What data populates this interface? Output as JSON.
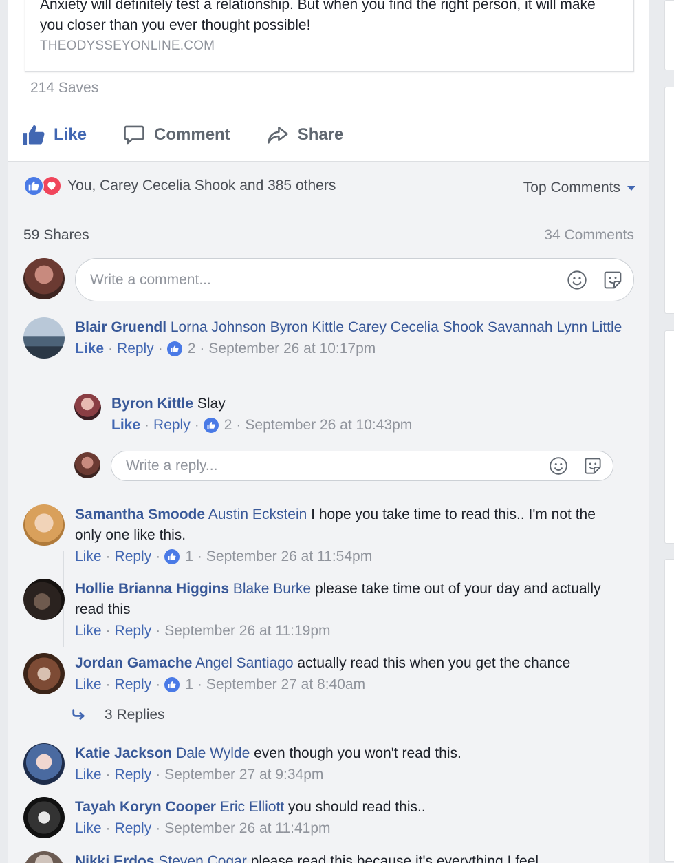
{
  "link_preview": {
    "description": "Anxiety will definitely test a relationship. But when you find the right person, it will make you closer than you ever thought possible!",
    "domain": "THEODYSSEYONLINE.COM"
  },
  "saves": "214 Saves",
  "actions": {
    "like": "Like",
    "comment": "Comment",
    "share": "Share"
  },
  "reactions": {
    "summary": "You, Carey Cecelia Shook and 385 others",
    "sort_label": "Top Comments"
  },
  "shares": "59 Shares",
  "comments_count": "34 Comments",
  "composer": {
    "placeholder": "Write a comment..."
  },
  "reply_composer": {
    "placeholder": "Write a reply..."
  },
  "meta_labels": {
    "like": "Like",
    "reply": "Reply",
    "dot": "·"
  },
  "comments": [
    {
      "author": "Blair Gruendl",
      "mentions": "Lorna Johnson Byron Kittle Carey Cecelia Shook Savannah Lynn Little",
      "text": "",
      "likes": "2",
      "time": "September 26 at 10:17pm",
      "liked": true
    },
    {
      "author": "Byron Kittle",
      "mentions": "",
      "text": "Slay",
      "likes": "2",
      "time": "September 26 at 10:43pm",
      "liked": true
    },
    {
      "author": "Samantha Smoode",
      "mentions": "Austin Eckstein",
      "text": "I hope you take time to read this.. I'm not the only one like this.",
      "likes": "1",
      "time": "September 26 at 11:54pm",
      "liked": false
    },
    {
      "author": "Hollie Brianna Higgins",
      "mentions": "Blake Burke",
      "text": "please take time out of your day and actually read this",
      "likes": "",
      "time": "September 26 at 11:19pm",
      "liked": false
    },
    {
      "author": "Jordan Gamache",
      "mentions": "Angel Santiago",
      "text": "actually read this when you get the chance",
      "likes": "1",
      "time": "September 27 at 8:40am",
      "liked": false
    },
    {
      "author": "Katie Jackson",
      "mentions": "Dale Wylde",
      "text": "even though you won't read this.",
      "likes": "",
      "time": "September 27 at 9:34pm",
      "liked": false
    },
    {
      "author": "Tayah Koryn Cooper",
      "mentions": "Eric Elliott",
      "text": "you should read this..",
      "likes": "",
      "time": "September 26 at 11:41pm",
      "liked": false
    },
    {
      "author": "Nikki Erdos",
      "mentions": "Steven Cogar",
      "text": "please read this because it's everything I feel",
      "likes": "",
      "time": "",
      "liked": false
    }
  ],
  "replies_link": "3 Replies",
  "icons": {
    "like": "thumbs-up-icon",
    "comment": "speech-bubble-icon",
    "share": "share-arrow-icon",
    "emoji": "smiley-icon",
    "sticker": "sticker-icon",
    "love": "heart-icon",
    "reply_arrow": "reply-arrow-icon"
  },
  "colors": {
    "link_blue": "#385898",
    "like_blue": "#4267b2",
    "reaction_blue": "#4a7ae6",
    "love_red": "#f0455b",
    "muted": "#90949c"
  }
}
